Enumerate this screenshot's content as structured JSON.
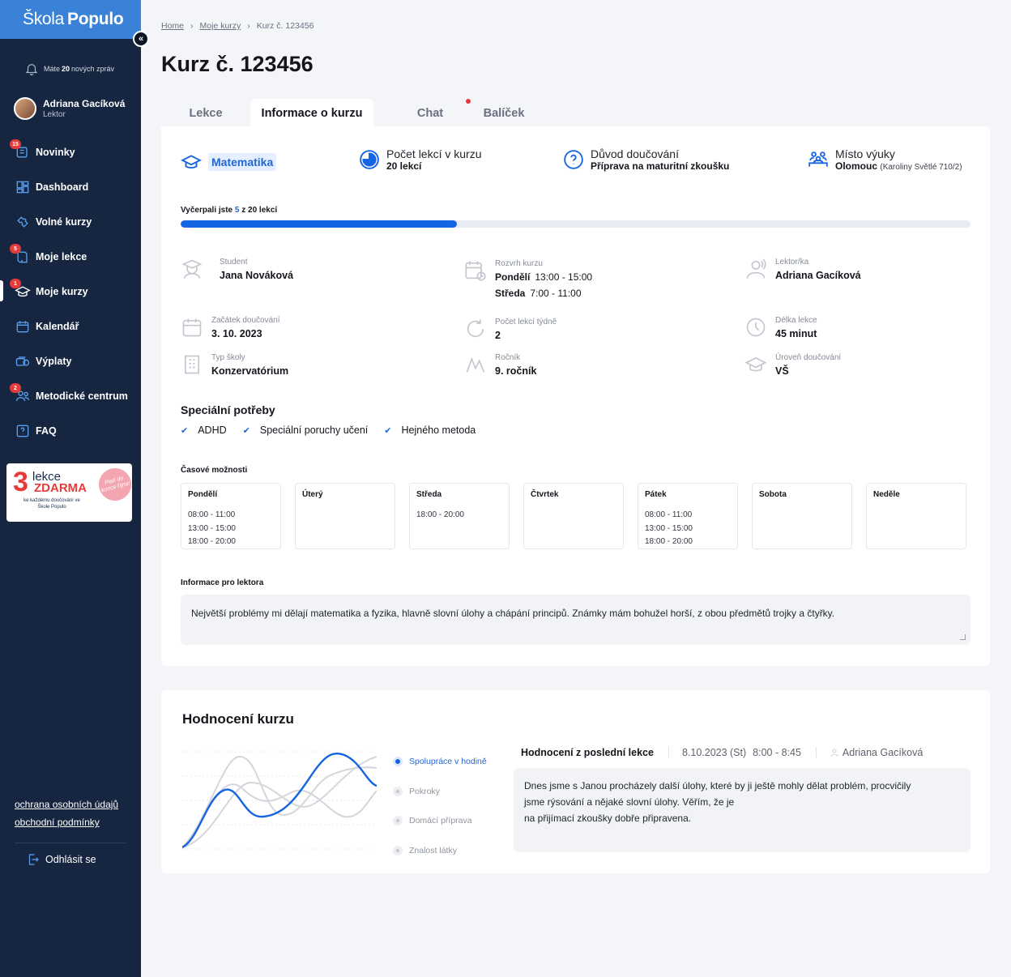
{
  "sidebar": {
    "logo_a": "Škola",
    "logo_b": "Populo",
    "collapse_glyph": "«",
    "notification": {
      "pre": "Máte",
      "count": "20",
      "post": "nových zpráv"
    },
    "user": {
      "name": "Adriana Gacíková",
      "role": "Lektor"
    },
    "items": [
      {
        "label": "Novinky",
        "badge": "15",
        "icon": "news-icon"
      },
      {
        "label": "Dashboard",
        "badge": "",
        "icon": "dashboard-icon"
      },
      {
        "label": "Volné kurzy",
        "badge": "",
        "icon": "puzzle-icon"
      },
      {
        "label": "Moje lekce",
        "badge": "5",
        "icon": "book-icon"
      },
      {
        "label": "Moje kurzy",
        "badge": "1",
        "icon": "graduation-cap-icon"
      },
      {
        "label": "Kalendář",
        "badge": "",
        "icon": "calendar-icon"
      },
      {
        "label": "Výplaty",
        "badge": "",
        "icon": "coins-icon"
      },
      {
        "label": "Metodické centrum",
        "badge": "2",
        "icon": "people-icon"
      },
      {
        "label": "FAQ",
        "badge": "",
        "icon": "question-icon"
      }
    ],
    "promo": {
      "number": "3",
      "line1": "lekce",
      "line2": "ZDARMA",
      "small": "ke každému doučování ve Škole Populo",
      "circle": "Platí do konce října!"
    },
    "links": [
      "ochrana osobních údajů",
      "obchodní podmínky"
    ],
    "logout": "Odhlásit se"
  },
  "breadcrumb": [
    "Home",
    "Moje kurzy",
    "Kurz č. 123456"
  ],
  "breadcrumb_sep": "›",
  "title": "Kurz č. 123456",
  "tabs": [
    "Lekce",
    "Informace o kurzu",
    "Chat",
    "Balíček"
  ],
  "info": {
    "subject": "Matematika",
    "lessons_label": "Počet lekcí v kurzu",
    "lessons_value": "20 lekcí",
    "reason_label": "Důvod doučování",
    "reason_value": "Příprava na maturitní zkoušku",
    "place_label": "Místo výuky",
    "place_value": "Olomouc",
    "place_detail": "(Karoliny Světlé 710/2)"
  },
  "progress": {
    "pre": "Vyčerpali jste",
    "used": "5",
    "mid": "z",
    "total": "20 lekcí",
    "fraction": 0.35
  },
  "details": {
    "student_label": "Student",
    "student": "Jana Nováková",
    "schedule_label": "Rozvrh kurzu",
    "schedule": [
      {
        "day": "Pondělí",
        "time": "13:00 - 15:00"
      },
      {
        "day": "Středa",
        "time": "7:00 - 11:00"
      }
    ],
    "lector_label": "Lektor/ka",
    "lector": "Adriana Gacíková",
    "start_label": "Začátek doučování",
    "start": "3. 10. 2023",
    "weekly_label": "Počet lekcí týdně",
    "weekly": "2",
    "length_label": "Délka lekce",
    "length": "45 minut",
    "school_label": "Typ školy",
    "school": "Konzervatórium",
    "grade_label": "Ročník",
    "grade": "9. ročník",
    "level_label": "Úroveň doučování",
    "level": "VŠ"
  },
  "special": {
    "title": "Speciální potřeby",
    "items": [
      "ADHD",
      "Speciální poruchy učení",
      "Hejného metoda"
    ]
  },
  "times": {
    "title": "Časové možnosti",
    "days": [
      {
        "name": "Pondělí",
        "slots": [
          "08:00 - 11:00",
          "13:00 - 15:00",
          "18:00 - 20:00"
        ]
      },
      {
        "name": "Úterý",
        "slots": []
      },
      {
        "name": "Středa",
        "slots": [
          "18:00 - 20:00"
        ]
      },
      {
        "name": "Čtvrtek",
        "slots": []
      },
      {
        "name": "Pátek",
        "slots": [
          "08:00 - 11:00",
          "13:00 - 15:00",
          "18:00 - 20:00"
        ]
      },
      {
        "name": "Sobota",
        "slots": []
      },
      {
        "name": "Neděle",
        "slots": []
      }
    ]
  },
  "lector_info": {
    "title": "Informace pro lektora",
    "text": "Největší problémy mi dělají matematika a fyzika, hlavně slovní úlohy a chápání principů. Známky mám bohužel horší, z obou předmětů trojky a čtyřky."
  },
  "rating": {
    "title": "Hodnocení kurzu",
    "legend": [
      "Spolupráce v hodině",
      "Pokroky",
      "Domácí příprava",
      "Znalost látky"
    ],
    "last_title": "Hodnocení z poslední lekce",
    "last_date": "8.10.2023 (St)",
    "last_time": "8:00 - 8:45",
    "last_lector": "Adriana Gacíková",
    "last_text_1": "Dnes jsme s Janou procházely další úlohy, které by ji ještě mohly dělat problém, procvičily",
    "last_text_2": "jsme rýsování a nějaké slovní úlohy. Věřím, že je",
    "last_text_3": "na přijímací zkoušky dobře připravena."
  },
  "colors": {
    "sidebar": "#162640",
    "accent": "#1564e2",
    "logo_bg": "#3a82d8",
    "badge": "#e53b3b"
  }
}
